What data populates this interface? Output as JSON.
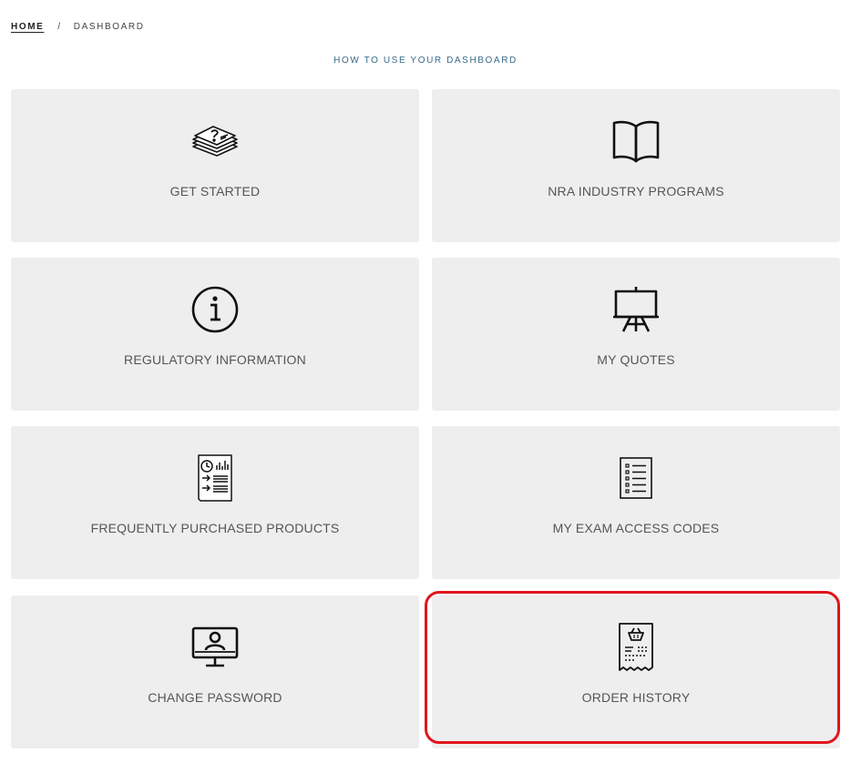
{
  "breadcrumb": {
    "home": "HOME",
    "separator": "/",
    "current": "DASHBOARD"
  },
  "help_link": "HOW TO USE YOUR DASHBOARD",
  "tiles": [
    {
      "label": "GET STARTED",
      "icon": "stack-of-papers-icon"
    },
    {
      "label": "NRA INDUSTRY PROGRAMS",
      "icon": "open-book-icon"
    },
    {
      "label": "REGULATORY INFORMATION",
      "icon": "info-circle-icon"
    },
    {
      "label": "MY QUOTES",
      "icon": "easel-presentation-icon"
    },
    {
      "label": "FREQUENTLY PURCHASED PRODUCTS",
      "icon": "report-document-icon"
    },
    {
      "label": "MY EXAM ACCESS CODES",
      "icon": "checklist-document-icon"
    },
    {
      "label": "CHANGE PASSWORD",
      "icon": "monitor-user-icon"
    },
    {
      "label": "ORDER HISTORY",
      "icon": "receipt-basket-icon"
    }
  ],
  "colors": {
    "tile_background": "#eeeeee",
    "tile_text": "#555555",
    "help_link": "#3a6a8a",
    "highlight": "#e0151c"
  }
}
